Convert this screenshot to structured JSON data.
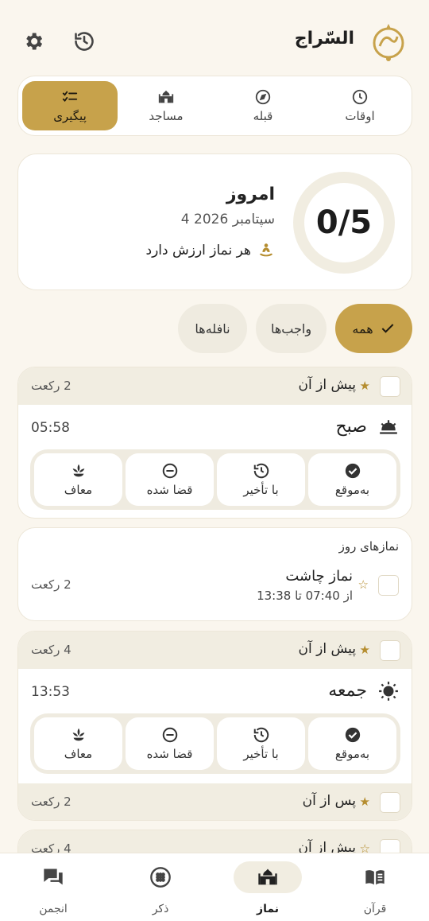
{
  "app": {
    "title": "السّراج"
  },
  "colors": {
    "accent": "#c7a24b",
    "background": "#faf6ee",
    "surface": "#ffffff",
    "muted": "#f1ede1"
  },
  "header": {
    "settings_icon": "gear-icon",
    "history_icon": "history-icon"
  },
  "tabs": [
    {
      "label": "اوقات",
      "icon": "clock-icon"
    },
    {
      "label": "قبله",
      "icon": "compass-icon"
    },
    {
      "label": "مساجد",
      "icon": "mosque-icon"
    },
    {
      "label": "پیگیری",
      "icon": "checklist-icon",
      "active": true
    }
  ],
  "today": {
    "progress": "0/5",
    "title": "امروز",
    "date": "4 سپتامبر 2026",
    "motto": "هر نماز ارزش دارد"
  },
  "filters": [
    {
      "label": "همه",
      "active": true
    },
    {
      "label": "واجب‌ها"
    },
    {
      "label": "نافله‌ها"
    }
  ],
  "status_options": [
    "به‌موقع",
    "با تأخیر",
    "قضا شده",
    "معاف"
  ],
  "blocks": {
    "fajr": {
      "before": {
        "label": "پیش از آن",
        "rakat": "2 رکعت"
      },
      "name": "صبح",
      "time": "05:58"
    },
    "daily": {
      "title": "نمازهای روز",
      "name": "نماز چاشت",
      "range": "از 07:40 تا 13:38",
      "rakat": "2 رکعت"
    },
    "jumuah": {
      "before": {
        "label": "پیش از آن",
        "rakat": "4 رکعت"
      },
      "name": "جمعه",
      "time": "13:53",
      "after": {
        "label": "پس از آن",
        "rakat": "2 رکعت"
      }
    },
    "next": {
      "before": {
        "label": "پیش از آن",
        "rakat": "4 رکعت"
      }
    }
  },
  "bottom_nav": [
    {
      "label": "قرآن",
      "icon": "book-icon"
    },
    {
      "label": "نماز",
      "icon": "mosque-icon",
      "active": true
    },
    {
      "label": "ذکر",
      "icon": "tasbih-icon"
    },
    {
      "label": "انجمن",
      "icon": "chat-icon"
    }
  ]
}
